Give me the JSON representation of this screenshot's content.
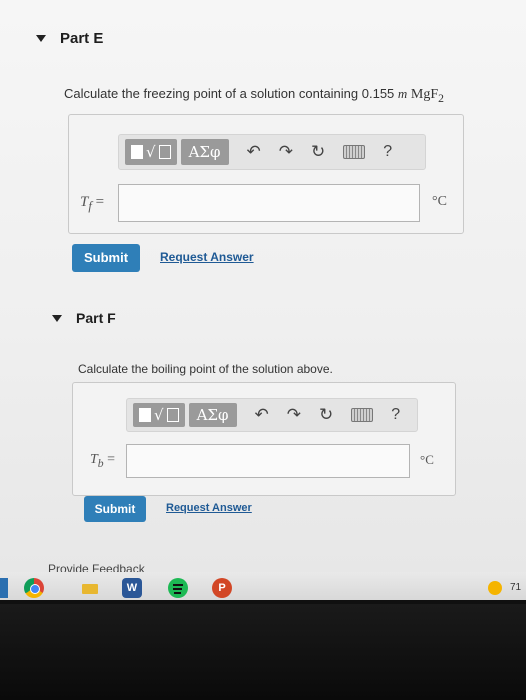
{
  "partE": {
    "title": "Part E",
    "question_prefix": "Calculate the freezing point of a solution containing 0.155 ",
    "molal": "m",
    "compound": "MgF",
    "subscript": "2",
    "var_main": "T",
    "var_sub": "f",
    "equals": "=",
    "unit": "°C",
    "submit_label": "Submit",
    "request_label": "Request Answer"
  },
  "partF": {
    "title": "Part F",
    "question": "Calculate the boiling point of the solution above.",
    "var_main": "T",
    "var_sub": "b",
    "equals": "=",
    "unit": "°C",
    "submit_label": "Submit",
    "request_label": "Request Answer"
  },
  "toolbar": {
    "template_symbol": "√",
    "greek_label": "ΑΣφ",
    "undo_icon": "↶",
    "redo_icon": "↷",
    "reset_icon": "↻",
    "help_label": "?"
  },
  "feedback_label": "Provide Feedback",
  "taskbar": {
    "word_label": "W",
    "powerpoint_label": "P",
    "tray_text": "71"
  }
}
